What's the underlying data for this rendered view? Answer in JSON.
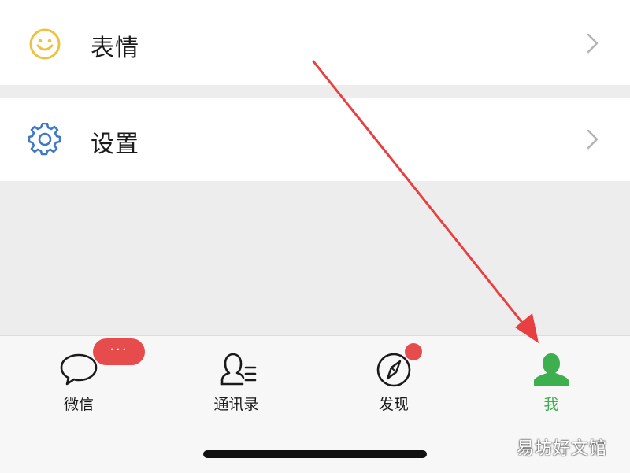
{
  "menu": {
    "items": [
      {
        "label": "表情",
        "icon": "smiley-icon"
      },
      {
        "label": "设置",
        "icon": "gear-icon"
      }
    ]
  },
  "tabbar": {
    "tabs": [
      {
        "label": "微信",
        "icon": "chat-bubble-icon"
      },
      {
        "label": "通讯录",
        "icon": "contacts-icon"
      },
      {
        "label": "发现",
        "icon": "compass-icon"
      },
      {
        "label": "我",
        "icon": "person-icon",
        "active": true
      }
    ],
    "chats_badge": "···"
  },
  "colors": {
    "active_tab": "#3daf4e",
    "badge": "#e74c4c",
    "annotation_arrow": "#e84040",
    "smiley": "#f0c23b",
    "gear": "#3f78c7"
  },
  "watermark": "易坊好文馆"
}
